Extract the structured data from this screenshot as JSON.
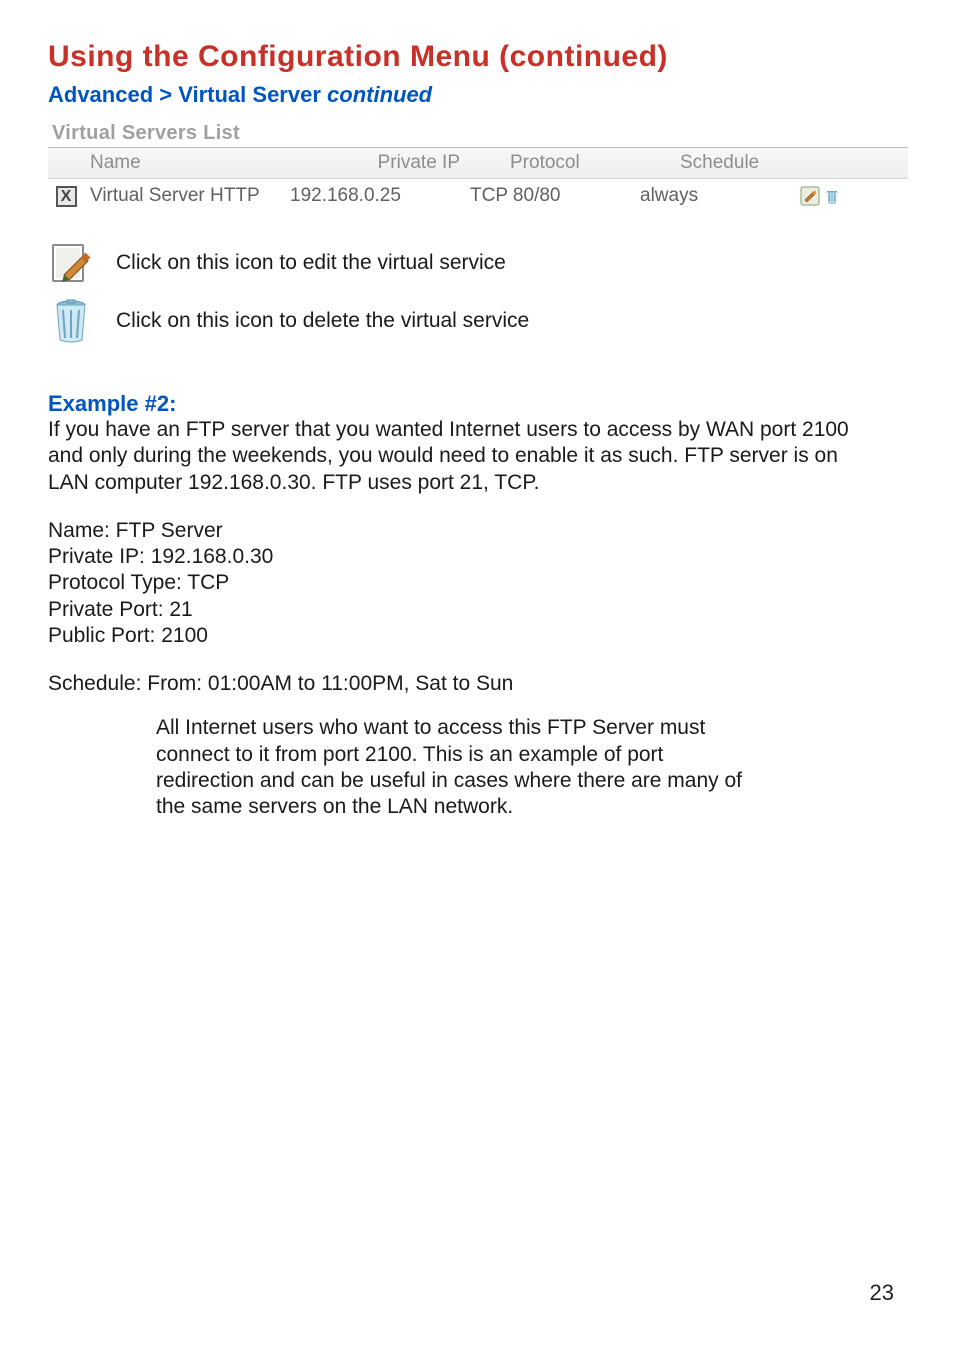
{
  "title": "Using the Configuration Menu (continued)",
  "subtitle_plain": "Advanced > Virtual Server ",
  "subtitle_italic": "continued",
  "vs_list": {
    "title": "Virtual Servers List",
    "headers": {
      "name": "Name",
      "private_ip": "Private IP",
      "protocol": "Protocol",
      "schedule": "Schedule"
    },
    "rows": [
      {
        "checked": true,
        "name": "Virtual Server HTTP",
        "private_ip": "192.168.0.25",
        "protocol": "TCP 80/80",
        "schedule": "always"
      }
    ]
  },
  "legend": {
    "edit": "Click on this icon to edit the virtual service",
    "delete": "Click on this icon to delete the virtual service"
  },
  "example": {
    "heading": "Example #2:",
    "para1": "If you have an FTP server that you wanted Internet users to access by WAN port 2100 and only during the weekends, you would need to enable it as such. FTP server is on LAN computer 192.168.0.30. FTP uses port 21, TCP.",
    "fields": [
      "Name: FTP Server",
      "Private IP: 192.168.0.30",
      "Protocol Type: TCP",
      "Private Port: 21",
      "Public Port: 2100"
    ],
    "schedule": "Schedule: From: 01:00AM to 11:00PM, Sat to Sun",
    "note": "All Internet users who want to access this FTP Server must connect to it from port 2100. This is an example of port redirection and can be useful in cases where there are many of the same servers on the LAN network."
  },
  "page_number": "23"
}
